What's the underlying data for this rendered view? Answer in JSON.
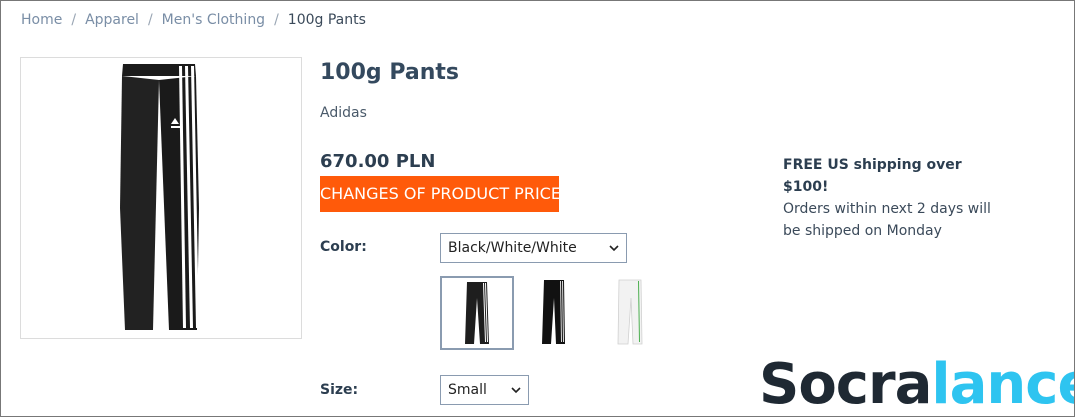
{
  "breadcrumb": {
    "items": [
      "Home",
      "Apparel",
      "Men's Clothing"
    ],
    "current": "100g Pants",
    "separator": "/"
  },
  "product": {
    "title": "100g Pants",
    "brand": "Adidas",
    "price": "670.00 PLN",
    "price_badge": "CHANGES OF PRODUCT PRICE",
    "badge_color": "#ff5a0a"
  },
  "shipping": {
    "headline": "FREE US shipping over $100!",
    "note": "Orders within next 2 days will be shipped on Monday"
  },
  "options": {
    "color_label": "Color:",
    "color_value": "Black/White/White",
    "size_label": "Size:",
    "size_value": "Small",
    "swatches": [
      {
        "name": "black-white",
        "selected": true
      },
      {
        "name": "black-white-alt",
        "selected": false
      },
      {
        "name": "white-green",
        "selected": false
      }
    ]
  },
  "watermark": {
    "part1": "Socra",
    "part2": "lance"
  },
  "icons": {
    "dropdown": "chevron-down-icon"
  }
}
